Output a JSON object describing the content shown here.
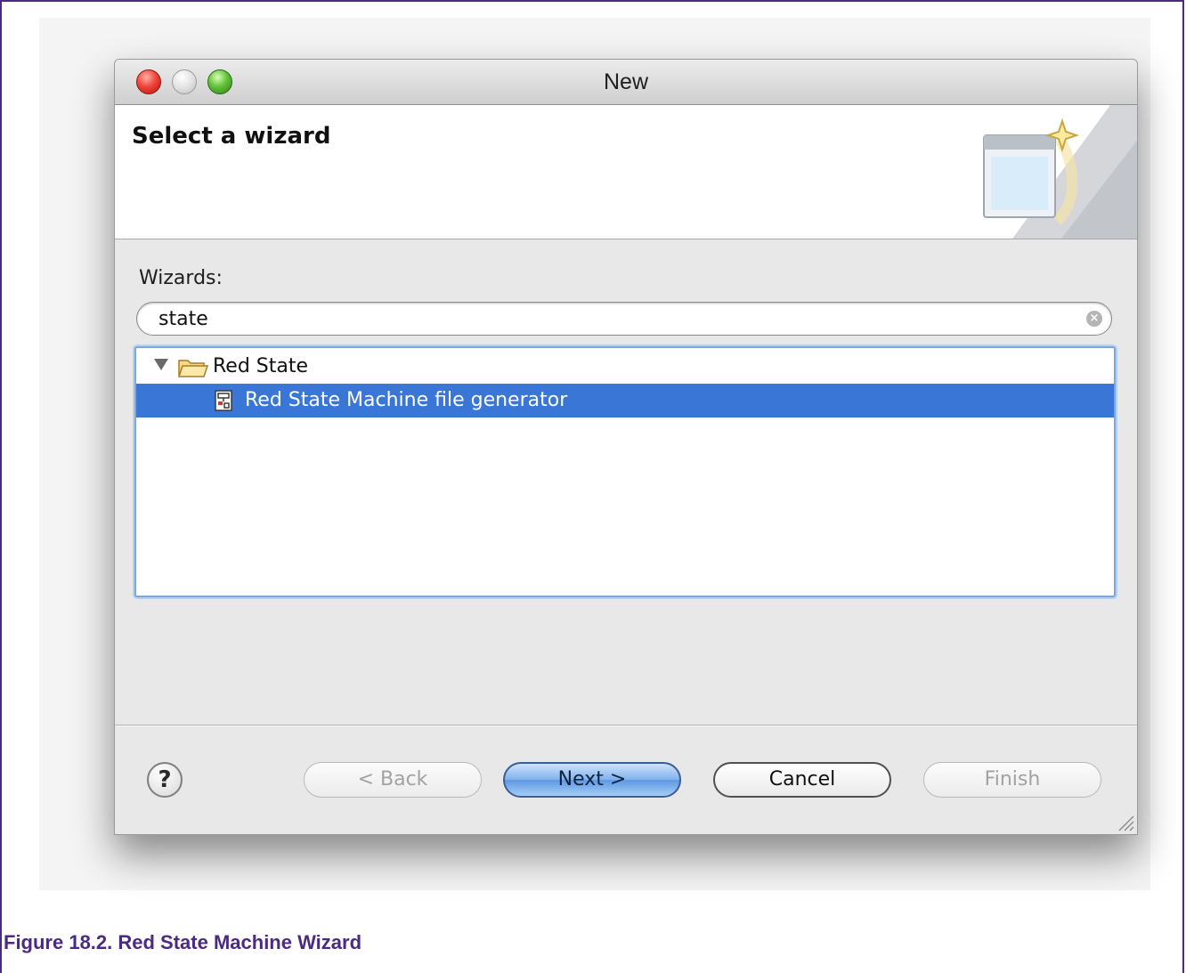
{
  "window": {
    "title": "New"
  },
  "header": {
    "title": "Select a wizard"
  },
  "wizards": {
    "label": "Wizards:",
    "filter_value": "state",
    "tree": {
      "category": "Red State",
      "items": [
        {
          "label": "Red State Machine file generator",
          "selected": true
        }
      ]
    }
  },
  "buttons": {
    "help_glyph": "?",
    "back": "< Back",
    "next": "Next >",
    "cancel": "Cancel",
    "finish": "Finish"
  },
  "icons": {
    "close": "close-window-icon",
    "minimize": "minimize-window-icon",
    "zoom": "zoom-window-icon",
    "banner": "new-wizard-banner-icon",
    "clear": "clear-search-icon",
    "folder": "folder-open-icon",
    "generator": "state-machine-file-icon",
    "help": "help-icon",
    "grip": "resize-grip-icon"
  },
  "colors": {
    "selection": "#3a76d6",
    "caption": "#4b2a82",
    "close_light": "#f0453a",
    "zoom_light": "#62c23b"
  },
  "caption": "Figure 18.2. Red State Machine Wizard"
}
